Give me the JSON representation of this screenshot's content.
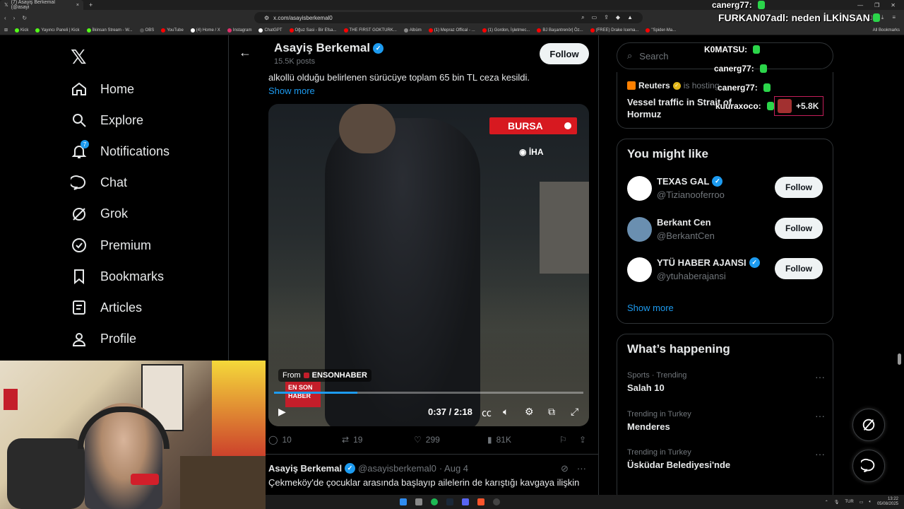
{
  "browser": {
    "tab_title": "(7) Asayiş Berkemal (@asayi",
    "tab_close": "×",
    "new_tab": "+",
    "window_controls": [
      "—",
      "❐",
      "✕"
    ],
    "url": "x.com/asayisberkemal0",
    "bookmarks": [
      {
        "label": "Kick",
        "color": "#53fc18"
      },
      {
        "label": "Yayıncı Paneli | Kick",
        "color": "#53fc18"
      },
      {
        "label": "İlkinsan Stream - W...",
        "color": "#53fc18"
      },
      {
        "label": "OBS",
        "color": "#555555"
      },
      {
        "label": "YouTube",
        "color": "#ff0000"
      },
      {
        "label": "(4) Home / X",
        "color": "#ffffff"
      },
      {
        "label": "Instagram",
        "color": "#e1306c"
      },
      {
        "label": "ChatGPT",
        "color": "#ffffff"
      },
      {
        "label": "Oğuz Sasi - Bir Efsa...",
        "color": "#ff0000"
      },
      {
        "label": "THE FIRST GOKTURK...",
        "color": "#ff0000"
      },
      {
        "label": "Albüm",
        "color": "#888888"
      },
      {
        "label": "(1) Mepraz Offical - ...",
        "color": "#ff0000"
      },
      {
        "label": "(1) Gordon, İşletmec...",
        "color": "#ff0000"
      },
      {
        "label": "BJ Başantrenör| Öz...",
        "color": "#ff0000"
      },
      {
        "label": "(FREE) Drake Icema...",
        "color": "#ff0000"
      },
      {
        "label": "\"Spider-Ma...",
        "color": "#ff0000"
      }
    ],
    "all_bookmarks": "All Bookmarks"
  },
  "nav": {
    "items": [
      {
        "label": "Home",
        "icon": "home-icon"
      },
      {
        "label": "Explore",
        "icon": "search-icon"
      },
      {
        "label": "Notifications",
        "icon": "bell-icon",
        "badge": "7"
      },
      {
        "label": "Chat",
        "icon": "chat-icon"
      },
      {
        "label": "Grok",
        "icon": "grok-icon"
      },
      {
        "label": "Premium",
        "icon": "verified-icon"
      },
      {
        "label": "Bookmarks",
        "icon": "bookmark-icon"
      },
      {
        "label": "Articles",
        "icon": "articles-icon"
      },
      {
        "label": "Profile",
        "icon": "profile-icon"
      }
    ]
  },
  "profile_header": {
    "name": "Asayiş Berkemal",
    "posts": "15.5K posts",
    "follow": "Follow"
  },
  "tweet": {
    "text": "alkollü olduğu belirlenen sürücüye toplam 65 bin TL ceza kesildi.",
    "show_more": "Show more",
    "video": {
      "location_tag": "BURSA",
      "agency": "İHA",
      "from_label": "From",
      "from_source": "ENSONHABER",
      "source_logo_text": "EN SON HABER",
      "time": "0:37 / 2:18",
      "progress": 0.27
    },
    "stats": {
      "replies": "10",
      "retweets": "19",
      "likes": "299",
      "views": "81K"
    }
  },
  "next_tweet": {
    "name": "Asayiş Berkemal",
    "handle": "@asayisberkemal0",
    "date": "· Aug 4",
    "text": "Çekmeköy'de çocuklar arasında başlayıp ailelerin de karıştığı kavgaya ilişkin"
  },
  "sidebar": {
    "search_placeholder": "Search",
    "trend_card": {
      "source": "Reuters",
      "status": "is hosting",
      "title": "Vessel traffic in Strait of Hormuz",
      "listeners": "+5.8K"
    },
    "who_to_follow": {
      "title": "You might like",
      "users": [
        {
          "name": "TEXAS GAL",
          "handle": "@Tizianooferroo",
          "verified": true,
          "follow": "Follow",
          "color": "#ffffff"
        },
        {
          "name": "Berkant Cen",
          "handle": "@BerkantCen",
          "verified": false,
          "follow": "Follow",
          "color": "#6a8fb0"
        },
        {
          "name": "YTÜ HABER AJANSI",
          "handle": "@ytuhaberajansi",
          "verified": true,
          "follow": "Follow",
          "color": "#ffffff"
        }
      ],
      "show_more": "Show more"
    },
    "happening": {
      "title": "What’s happening",
      "trends": [
        {
          "meta": "Sports · Trending",
          "name": "Salah 10"
        },
        {
          "meta": "Trending in Turkey",
          "name": "Menderes"
        },
        {
          "meta": "Trending in Turkey",
          "name": "Üsküdar Belediyesi'nde"
        }
      ]
    }
  },
  "chat_overlay": [
    {
      "user": "canerg77:",
      "text": ""
    },
    {
      "user": "FURKAN07adl:",
      "text": "neden İLKİNSAN"
    },
    {
      "user": "K0MATSU:",
      "text": ""
    },
    {
      "user": "canerg77:",
      "text": ""
    },
    {
      "user": "canerg77:",
      "text": ""
    },
    {
      "user": "kuuraxoco:",
      "text": ""
    }
  ],
  "taskbar": {
    "lang": "TUR",
    "time": "13:22",
    "date": "05/08/2025"
  }
}
